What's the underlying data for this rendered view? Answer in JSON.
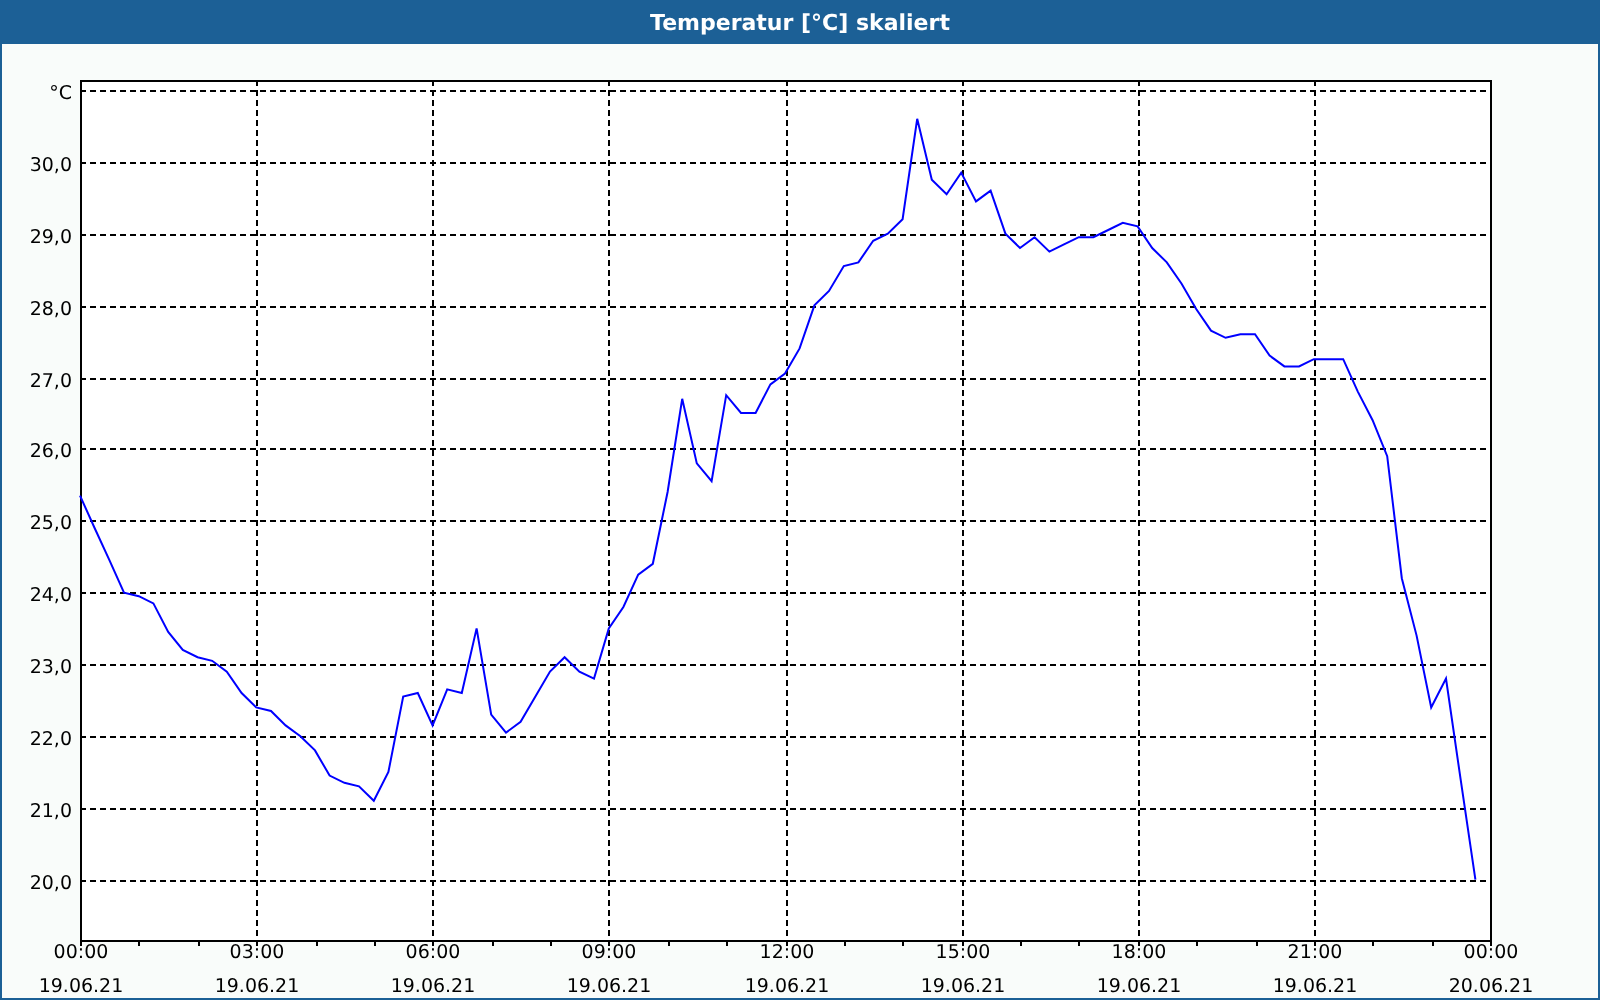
{
  "window": {
    "title": "Temperatur [°C] skaliert"
  },
  "chart_data": {
    "type": "line",
    "grid": true,
    "ylim": [
      19.16,
      31.14
    ],
    "yticks": [
      {
        "value": 20,
        "label": "20,0"
      },
      {
        "value": 21,
        "label": "21,0"
      },
      {
        "value": 22,
        "label": "22,0"
      },
      {
        "value": 23,
        "label": "23,0"
      },
      {
        "value": 24,
        "label": "24,0"
      },
      {
        "value": 25,
        "label": "25,0"
      },
      {
        "value": 26,
        "label": "26,0"
      },
      {
        "value": 27,
        "label": "27,0"
      },
      {
        "value": 28,
        "label": "28,0"
      },
      {
        "value": 29,
        "label": "29,0"
      },
      {
        "value": 30,
        "label": "30,0"
      },
      {
        "value": 31,
        "label": "°C"
      }
    ],
    "categories": [
      "00:00 19.06.21",
      null,
      null,
      null,
      null,
      null,
      null,
      null,
      null,
      null,
      null,
      null,
      "03:00 19.06.21",
      null,
      null,
      null,
      null,
      null,
      null,
      null,
      null,
      null,
      null,
      null,
      "06:00 19.06.21",
      null,
      null,
      null,
      null,
      null,
      null,
      null,
      null,
      null,
      null,
      null,
      "09:00 19.06.21",
      null,
      null,
      null,
      null,
      null,
      null,
      null,
      null,
      null,
      null,
      null,
      "12:00 19.06.21",
      null,
      null,
      null,
      null,
      null,
      null,
      null,
      null,
      null,
      null,
      null,
      "15:00 19.06.21",
      null,
      null,
      null,
      null,
      null,
      null,
      null,
      null,
      null,
      null,
      null,
      "18:00 19.06.21",
      null,
      null,
      null,
      null,
      null,
      null,
      null,
      null,
      null,
      null,
      null,
      "21:00 19.06.21",
      null,
      null,
      null,
      null,
      null,
      null,
      null,
      null,
      null,
      null,
      null,
      "00:00 20.06.21"
    ],
    "series": [
      {
        "color": "#0000ff",
        "values": [
          25.35,
          24.9,
          24.45,
          24.0,
          23.95,
          23.85,
          23.45,
          23.2,
          23.1,
          23.05,
          22.9,
          22.6,
          22.4,
          22.35,
          22.15,
          22.0,
          21.8,
          21.45,
          21.35,
          21.3,
          21.1,
          21.5,
          22.55,
          22.6,
          22.15,
          22.65,
          22.6,
          23.5,
          22.3,
          22.05,
          22.2,
          22.55,
          22.9,
          23.1,
          22.9,
          22.8,
          23.5,
          23.8,
          24.25,
          24.4,
          25.4,
          26.7,
          25.8,
          25.55,
          26.75,
          26.5,
          26.5,
          26.9,
          27.05,
          27.4,
          28.0,
          28.2,
          28.55,
          28.6,
          28.9,
          29.0,
          29.2,
          30.6,
          29.75,
          29.55,
          29.85,
          29.45,
          29.6,
          29.0,
          28.8,
          28.95,
          28.75,
          28.85,
          28.95,
          28.95,
          29.05,
          29.15,
          29.1,
          28.8,
          28.6,
          28.3,
          27.95,
          27.65,
          27.55,
          27.6,
          27.6,
          27.3,
          27.15,
          27.15,
          27.25,
          27.25,
          27.25,
          26.8,
          26.4,
          25.9,
          24.2,
          23.4,
          22.4,
          22.8,
          21.4,
          20.0,
          null
        ]
      }
    ]
  }
}
